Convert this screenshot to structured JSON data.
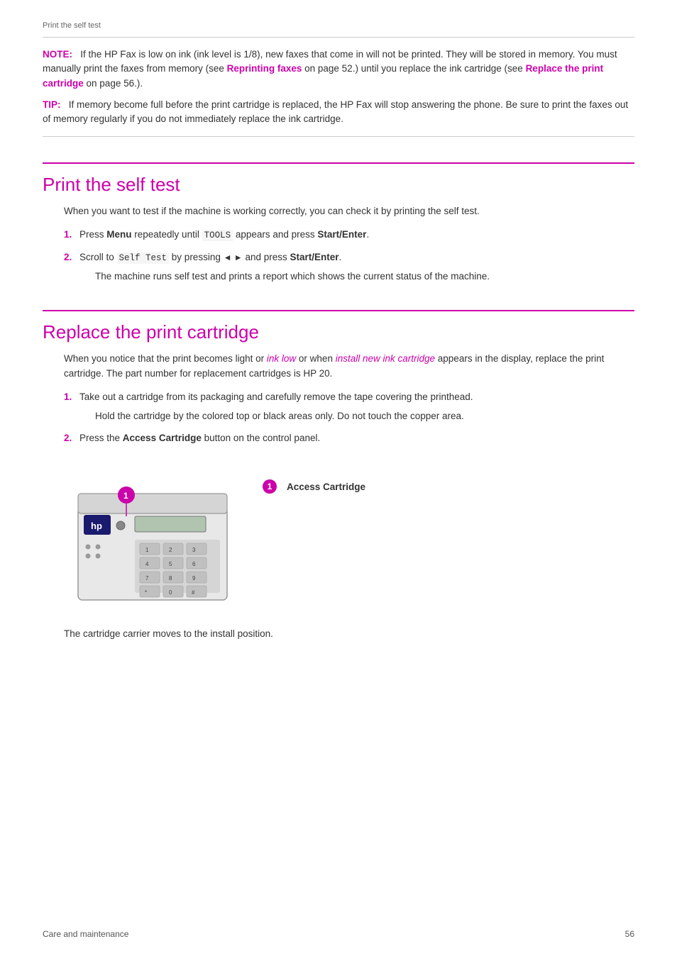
{
  "breadcrumb": "Print the self test",
  "footer": {
    "left": "Care and maintenance",
    "right": "56"
  },
  "note_box": {
    "note_label": "NOTE:",
    "note_text_1": "If the HP Fax is low on ink (ink level is 1/8), new faxes that come in will not be printed. They will be stored in memory. You must manually print the faxes from memory (see ",
    "note_link1": "Reprinting faxes",
    "note_text_2": " on page 52.) until you replace the ink cartridge (see ",
    "note_link2": "Replace the print cartridge",
    "note_text_3": " on page 56.).",
    "tip_label": "TIP:",
    "tip_text": "If memory become full before the print cartridge is replaced, the HP Fax will stop answering the phone. Be sure to print the faxes out of memory regularly if you do not immediately replace the ink cartridge."
  },
  "section1": {
    "heading": "Print the self test",
    "intro": "When you want to test if the machine is working correctly, you can check it by printing the self test.",
    "steps": [
      {
        "num": "1.",
        "text_parts": [
          {
            "text": "Press ",
            "style": "normal"
          },
          {
            "text": "Menu",
            "style": "bold"
          },
          {
            "text": " repeatedly until ",
            "style": "normal"
          },
          {
            "text": "TOOLS",
            "style": "mono"
          },
          {
            "text": " appears and press ",
            "style": "normal"
          },
          {
            "text": "Start/Enter",
            "style": "bold"
          },
          {
            "text": ".",
            "style": "normal"
          }
        ]
      },
      {
        "num": "2.",
        "text_parts": [
          {
            "text": "Scroll to ",
            "style": "normal"
          },
          {
            "text": "Self Test",
            "style": "mono"
          },
          {
            "text": " by pressing ",
            "style": "normal"
          },
          {
            "text": "◄ ►",
            "style": "normal"
          },
          {
            "text": " and press ",
            "style": "normal"
          },
          {
            "text": "Start/Enter",
            "style": "bold"
          },
          {
            "text": ".",
            "style": "normal"
          }
        ],
        "subtext": "The machine runs self test and prints a report which shows the current status of the machine."
      }
    ]
  },
  "section2": {
    "heading": "Replace the print cartridge",
    "intro_parts": [
      {
        "text": "When you notice that the print becomes light or ",
        "style": "normal"
      },
      {
        "text": "ink low",
        "style": "pink-italic"
      },
      {
        "text": " or when ",
        "style": "normal"
      },
      {
        "text": "install new ink cartridge",
        "style": "pink-italic"
      },
      {
        "text": " appears in the display, replace the print cartridge. The part number for replacement cartridges is HP 20.",
        "style": "normal"
      }
    ],
    "steps": [
      {
        "num": "1.",
        "text": "Take out a cartridge from its packaging and carefully remove the tape covering the printhead.",
        "subtext": "Hold the cartridge by the colored top or black areas only. Do not touch the copper area."
      },
      {
        "num": "2.",
        "text_parts": [
          {
            "text": "Press the ",
            "style": "normal"
          },
          {
            "text": "Access Cartridge",
            "style": "bold"
          },
          {
            "text": " button on the control panel.",
            "style": "normal"
          }
        ]
      }
    ],
    "callout": {
      "number": "1",
      "label": "Access Cartridge"
    },
    "figure_caption": "The cartridge carrier moves to the install position."
  }
}
